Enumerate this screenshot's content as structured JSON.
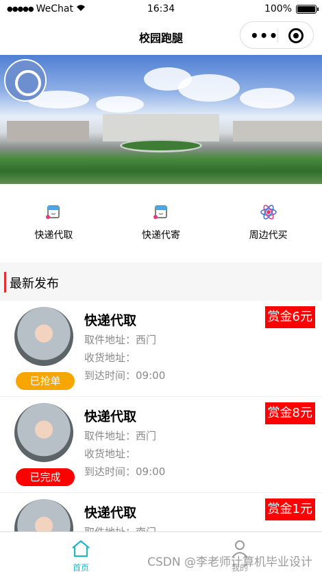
{
  "status_bar": {
    "carrier": "WeChat",
    "time": "16:34",
    "battery": "100%"
  },
  "nav": {
    "title": "校园跑腿"
  },
  "menu": [
    {
      "icon": "box-icon",
      "label": "快递代取"
    },
    {
      "icon": "box-icon",
      "label": "快递代寄"
    },
    {
      "icon": "atom-icon",
      "label": "周边代买"
    }
  ],
  "section_title": "最新发布",
  "orders": [
    {
      "title": "快递代取",
      "pickup_label": "取件地址：",
      "pickup": "西门",
      "delivery_label": "收货地址：",
      "delivery": "",
      "arrival_label": "到达时间：",
      "arrival": "09:00",
      "reward": "赏金6元",
      "status": "已抢单",
      "status_color": "#f7a600"
    },
    {
      "title": "快递代取",
      "pickup_label": "取件地址：",
      "pickup": "西门",
      "delivery_label": "收货地址：",
      "delivery": "",
      "arrival_label": "到达时间：",
      "arrival": "09:00",
      "reward": "赏金8元",
      "status": "已完成",
      "status_color": "#ff0000"
    },
    {
      "title": "快递代取",
      "pickup_label": "取件地址：",
      "pickup": "南门",
      "delivery_label": "收货地址：",
      "delivery": "",
      "arrival_label": "到达时间：",
      "arrival": "",
      "reward": "赏金1元",
      "status": "",
      "status_color": ""
    }
  ],
  "tabbar": {
    "home": "首页",
    "mine": "我的"
  },
  "watermark": "CSDN @李老师计算机毕业设计",
  "colors": {
    "accent": "#1fb6c9",
    "reward_bg": "#ff0000"
  }
}
